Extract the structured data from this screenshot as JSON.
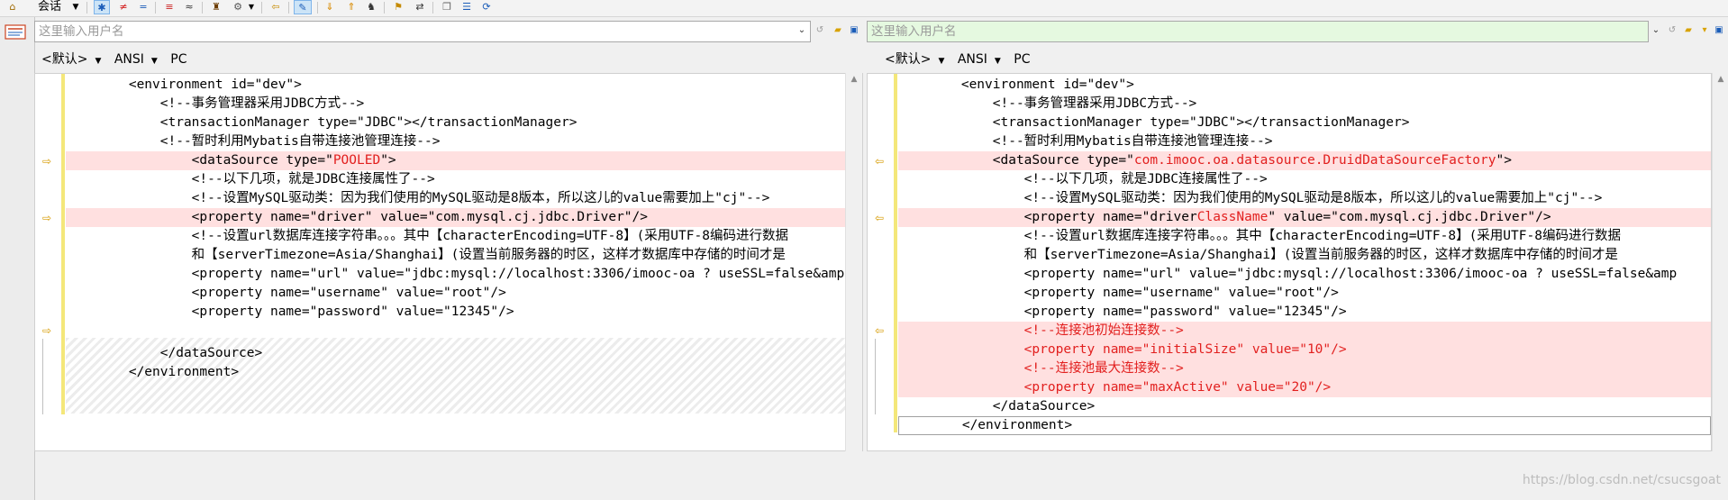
{
  "toolbar": {
    "session_label": "会话",
    "items": [
      {
        "name": "session-icon",
        "glyph": "⚙"
      },
      {
        "name": "show-all-icon",
        "glyph": "✱"
      },
      {
        "name": "show-diff-icon",
        "glyph": "≠"
      },
      {
        "name": "show-same-icon",
        "glyph": "="
      },
      {
        "name": "context-icon",
        "glyph": "≡"
      },
      {
        "name": "ignore-icon",
        "glyph": "≈"
      },
      {
        "name": "rules-icon",
        "glyph": "♜"
      },
      {
        "name": "options-icon",
        "glyph": "⚙"
      },
      {
        "name": "home-icon",
        "glyph": "⇦"
      },
      {
        "name": "edit-icon",
        "glyph": "✎"
      },
      {
        "name": "next-diff-icon",
        "glyph": "⇓"
      },
      {
        "name": "prev-diff-icon",
        "glyph": "⇑"
      },
      {
        "name": "find-icon",
        "glyph": "♞"
      },
      {
        "name": "bookmark-icon",
        "glyph": "⚑"
      },
      {
        "name": "swap-icon",
        "glyph": "⇄"
      },
      {
        "name": "copy-icon",
        "glyph": "❐"
      },
      {
        "name": "lines-icon",
        "glyph": "☰"
      },
      {
        "name": "sync-icon",
        "glyph": "⟳"
      }
    ]
  },
  "left": {
    "path_placeholder": "这里输入用户名",
    "format": {
      "encoding_default": "<默认>",
      "charset": "ANSI",
      "line_endings": "PC"
    },
    "lines": [
      {
        "text": "        <environment id=\"dev\">"
      },
      {
        "text": "            <!--事务管理器采用JDBC方式-->"
      },
      {
        "text": "            <transactionManager type=\"JDBC\"></transactionManager>"
      },
      {
        "text": "            <!--暂时利用Mybatis自带连接池管理连接-->"
      },
      {
        "text": "                <dataSource type=\"",
        "hl": "POOLED",
        "after": "\">",
        "diff": true
      },
      {
        "text": "                <!--以下几项，就是JDBC连接属性了-->"
      },
      {
        "text": "                <!--设置MySQL驱动类：因为我们使用的MySQL驱动是8版本，所以这儿的value需要加上\"cj\"-->"
      },
      {
        "text": "                <property name=\"driver\" value=\"com.mysql.cj.jdbc.Driver\"/>",
        "diff": true
      },
      {
        "text": "                <!--设置url数据库连接字符串。。。其中【characterEncoding=UTF-8】(采用UTF-8编码进行数据"
      },
      {
        "text": "                和【serverTimezone=Asia/Shanghai】(设置当前服务器的时区，这样才数据库中存储的时间才是"
      },
      {
        "text": "                <property name=\"url\" value=\"jdbc:mysql://localhost:3306/imooc-oa ? useSSL=false&amp"
      },
      {
        "text": "                <property name=\"username\" value=\"root\"/>"
      },
      {
        "text": "                <property name=\"password\" value=\"12345\"/>"
      },
      {
        "text": "            </dataSource>"
      },
      {
        "text": "        </environment>"
      }
    ]
  },
  "right": {
    "path_placeholder": "这里输入用户名",
    "format": {
      "encoding_default": "<默认>",
      "charset": "ANSI",
      "line_endings": "PC"
    },
    "lines": [
      {
        "text": "        <environment id=\"dev\">"
      },
      {
        "text": "            <!--事务管理器采用JDBC方式-->"
      },
      {
        "text": "            <transactionManager type=\"JDBC\"></transactionManager>"
      },
      {
        "text": "            <!--暂时利用Mybatis自带连接池管理连接-->"
      },
      {
        "text": "            <dataSource type=\"",
        "hl": "com.imooc.oa.datasource.DruidDataSourceFactory",
        "after": "\">",
        "diff": true
      },
      {
        "text": "                <!--以下几项，就是JDBC连接属性了-->"
      },
      {
        "text": "                <!--设置MySQL驱动类：因为我们使用的MySQL驱动是8版本，所以这儿的value需要加上\"cj\"-->"
      },
      {
        "text": "                <property name=\"driver",
        "hl": "ClassName",
        "after": "\" value=\"com.mysql.cj.jdbc.Driver\"/>",
        "diff": true
      },
      {
        "text": "                <!--设置url数据库连接字符串。。。其中【characterEncoding=UTF-8】(采用UTF-8编码进行数据"
      },
      {
        "text": "                和【serverTimezone=Asia/Shanghai】(设置当前服务器的时区，这样才数据库中存储的时间才是"
      },
      {
        "text": "                <property name=\"url\" value=\"jdbc:mysql://localhost:3306/imooc-oa ? useSSL=false&amp"
      },
      {
        "text": "                <property name=\"username\" value=\"root\"/>"
      },
      {
        "text": "                <property name=\"password\" value=\"12345\"/>"
      },
      {
        "text": "                <!--连接池初始连接数-->",
        "diff": true,
        "red": true
      },
      {
        "text": "                <property name=\"initialSize\" value=\"10\"/>",
        "diff": true,
        "red": true
      },
      {
        "text": "                <!--连接池最大连接数-->",
        "diff": true,
        "red": true
      },
      {
        "text": "                <property name=\"maxActive\" value=\"20\"/>",
        "diff": true,
        "red": true
      },
      {
        "text": "            </dataSource>"
      },
      {
        "text": "        </environment>",
        "cursor": true
      }
    ]
  },
  "watermark": "https://blog.csdn.net/csucsgoat",
  "colors": {
    "diff_bg": "#ffe0e0",
    "diff_text": "#e2201f",
    "change_bar": "#f4e77a",
    "right_path_bg": "#e5f9e0"
  }
}
